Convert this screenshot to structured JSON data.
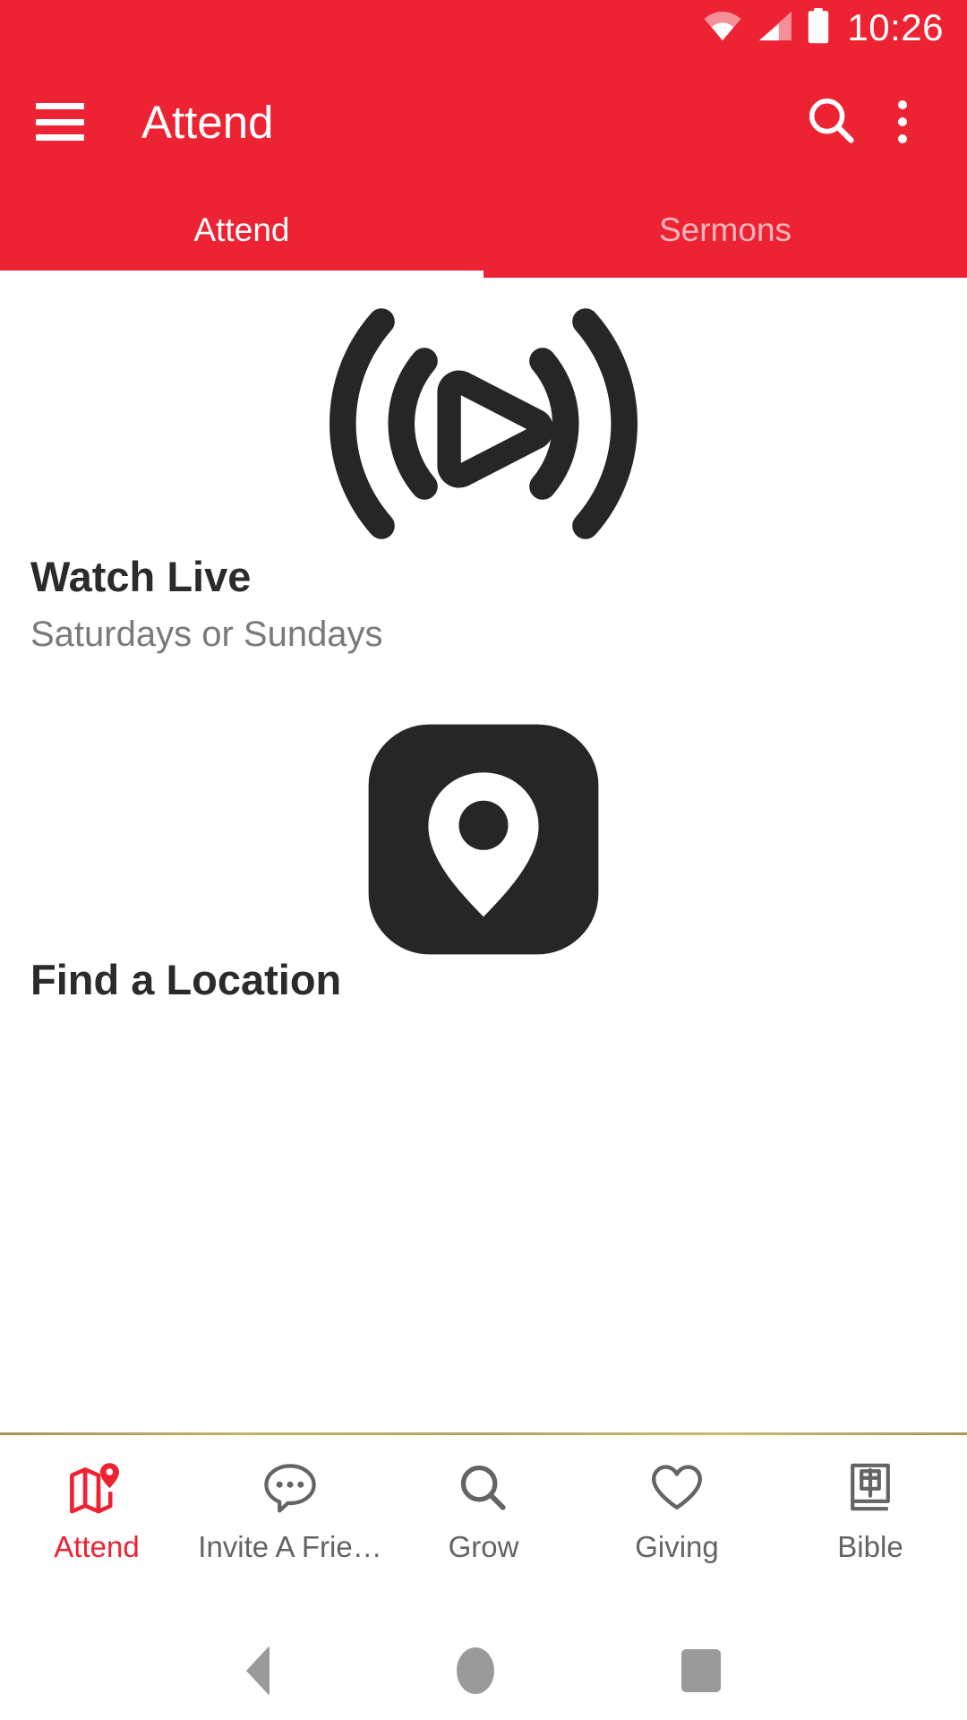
{
  "status_bar": {
    "time": "10:26",
    "icons": [
      "wifi-icon",
      "cellular-signal-icon",
      "battery-icon"
    ]
  },
  "app_bar": {
    "menu_icon": "hamburger-menu-icon",
    "title": "Attend",
    "search_icon": "search-icon",
    "overflow_icon": "more-vertical-icon"
  },
  "tabs": {
    "active_index": 0,
    "items": [
      {
        "label": "Attend"
      },
      {
        "label": "Sermons"
      }
    ]
  },
  "main": {
    "cards": [
      {
        "icon": "live-broadcast-play-icon",
        "title": "Watch Live",
        "subtitle": "Saturdays or Sundays"
      },
      {
        "icon": "map-location-pin-icon",
        "title": "Find a Location",
        "subtitle": ""
      }
    ]
  },
  "bottom_nav": {
    "active_index": 0,
    "items": [
      {
        "label": "Attend",
        "icon": "map-pin-icon"
      },
      {
        "label": "Invite A Frie…",
        "icon": "chat-bubble-icon"
      },
      {
        "label": "Grow",
        "icon": "search-icon"
      },
      {
        "label": "Giving",
        "icon": "heart-icon"
      },
      {
        "label": "Bible",
        "icon": "bible-book-icon"
      }
    ]
  },
  "system_nav": {
    "back": "back-triangle-icon",
    "home": "home-circle-icon",
    "recents": "recents-square-icon"
  },
  "colors": {
    "brand_red": "#ED2333",
    "tab_inactive": "#F9B6BD",
    "icon_dark": "#262626",
    "nav_idle": "#646464",
    "subtitle_gray": "#7a7a7a"
  }
}
